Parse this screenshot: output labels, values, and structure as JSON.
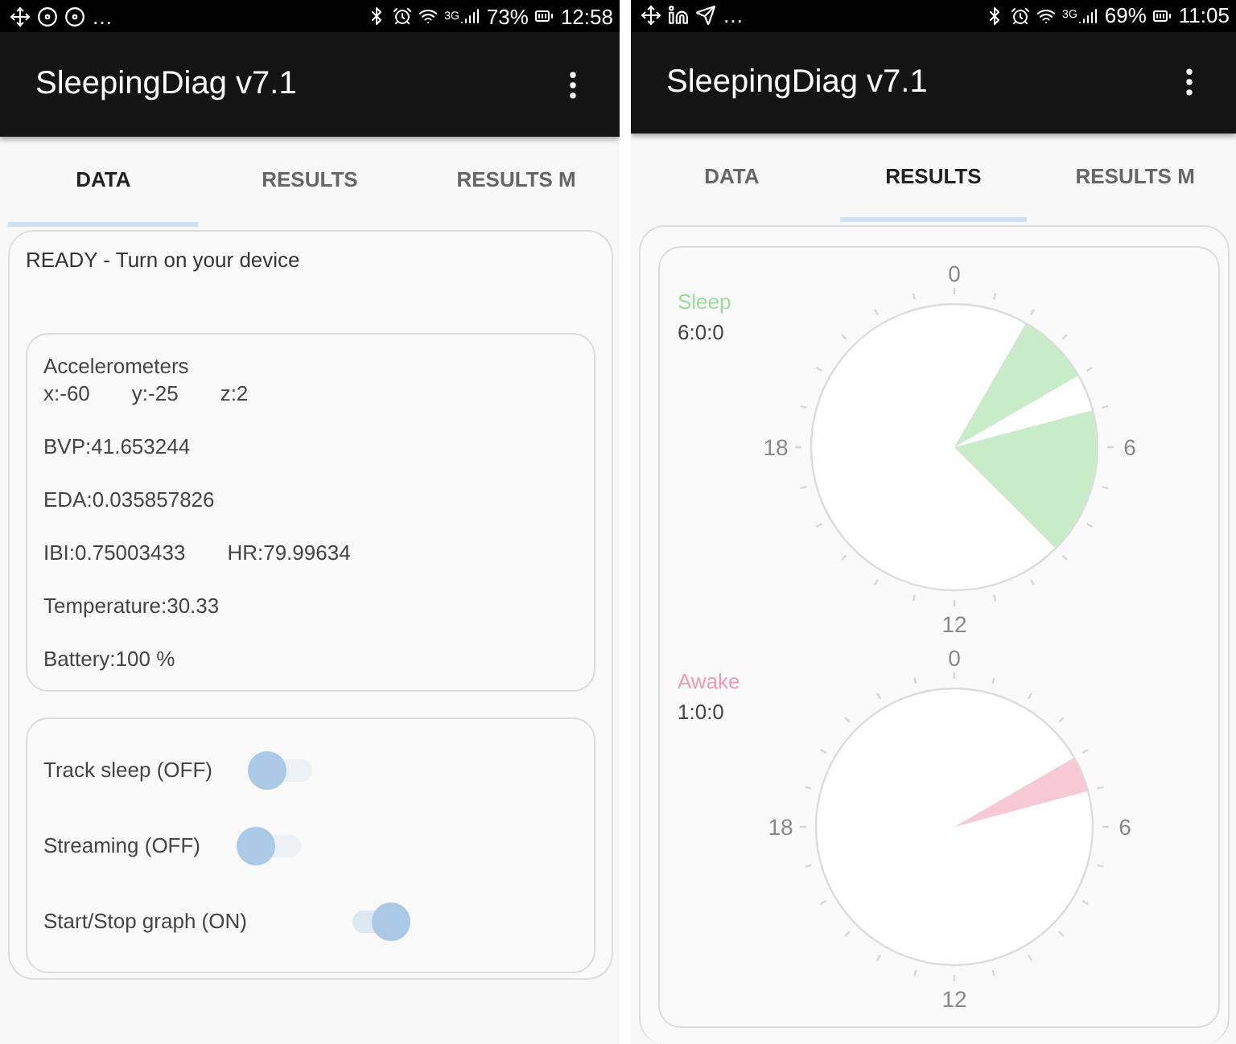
{
  "phones": [
    {
      "status_bar": {
        "more": "…",
        "network": "3G",
        "battery": "73%",
        "time": "12:58"
      },
      "app_bar": {
        "title": "SleepingDiag v7.1"
      },
      "tabs": [
        {
          "label": "DATA",
          "selected": true
        },
        {
          "label": "RESULTS",
          "selected": false
        },
        {
          "label": "RESULTS M",
          "selected": false
        }
      ],
      "screen": {
        "kind": "data",
        "status_message": "READY - Turn on your device",
        "sensors": {
          "title": "Accelerometers",
          "axes": [
            "x:-60",
            "y:-25",
            "z:2"
          ],
          "rows": [
            [
              "BVP:41.653244"
            ],
            [
              "EDA:0.035857826"
            ],
            [
              "IBI:0.75003433",
              "HR:79.99634"
            ],
            [
              "Temperature:30.33"
            ],
            [
              "Battery:100 %"
            ]
          ]
        },
        "switches": [
          {
            "label": "Track sleep (OFF)",
            "on": false
          },
          {
            "label": "Streaming (OFF)",
            "on": false
          },
          {
            "label": "Start/Stop graph (ON)",
            "on": true
          }
        ]
      }
    },
    {
      "status_bar": {
        "more": "…",
        "network": "3G",
        "battery": "69%",
        "time": "11:05"
      },
      "app_bar": {
        "title": "SleepingDiag v7.1"
      },
      "tabs": [
        {
          "label": "DATA",
          "selected": false
        },
        {
          "label": "RESULTS",
          "selected": true
        },
        {
          "label": "RESULTS M",
          "selected": false
        }
      ],
      "screen": {
        "kind": "results",
        "dials": [
          {
            "label": "Sleep",
            "color": "#99dd99",
            "duration": "6:0:0",
            "hour_labels": [
              "0",
              "6",
              "12",
              "18"
            ]
          },
          {
            "label": "Awake",
            "color": "#f09ab4",
            "duration": "1:0:0",
            "hour_labels": [
              "0",
              "6",
              "12",
              "18"
            ]
          }
        ]
      }
    }
  ]
}
